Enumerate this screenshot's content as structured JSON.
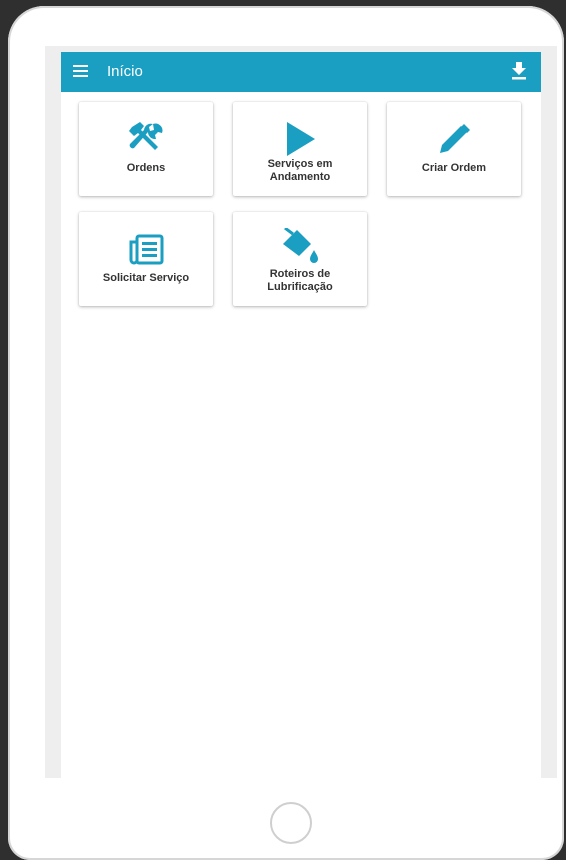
{
  "app": {
    "title": "Início",
    "accent_color": "#1a9ec1",
    "menu_icon": "hamburger-menu-icon",
    "download_icon": "download-icon"
  },
  "tiles": [
    {
      "label": "Ordens",
      "icon": "tools-icon"
    },
    {
      "label": "Serviços em Andamento",
      "icon": "play-icon"
    },
    {
      "label": "Criar Ordem",
      "icon": "pencil-icon"
    },
    {
      "label": "Solicitar Serviço",
      "icon": "newspaper-icon"
    },
    {
      "label": "Roteiros de Lubrificação",
      "icon": "paint-bucket-icon"
    }
  ]
}
